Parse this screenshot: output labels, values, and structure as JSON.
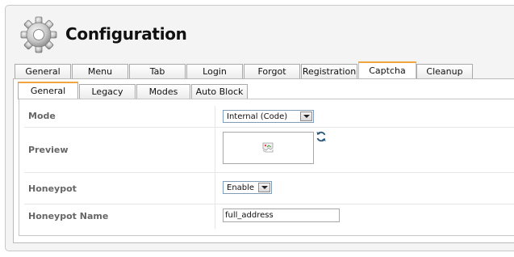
{
  "header": {
    "title": "Configuration",
    "icon": "gear-icon"
  },
  "main_tabs": [
    {
      "label": "General",
      "active": false
    },
    {
      "label": "Menu",
      "active": false
    },
    {
      "label": "Tab",
      "active": false
    },
    {
      "label": "Login",
      "active": false
    },
    {
      "label": "Forgot Login",
      "active": false
    },
    {
      "label": "Registration",
      "active": false
    },
    {
      "label": "Captcha",
      "active": true
    },
    {
      "label": "Cleanup",
      "active": false
    }
  ],
  "sub_tabs": [
    {
      "label": "General",
      "active": true
    },
    {
      "label": "Legacy",
      "active": false
    },
    {
      "label": "Modes",
      "active": false
    },
    {
      "label": "Auto Block",
      "active": false
    }
  ],
  "settings": {
    "mode": {
      "label": "Mode",
      "value": "Internal (Code)"
    },
    "preview": {
      "label": "Preview",
      "image_icon": "broken-image-icon",
      "refresh_icon": "refresh-icon"
    },
    "honeypot": {
      "label": "Honeypot",
      "value": "Enable"
    },
    "honeypot_name": {
      "label": "Honeypot Name",
      "value": "full_address"
    }
  },
  "colors": {
    "active_tab_accent": "#f0a640",
    "label_text": "#666666",
    "panel_bg": "#f4f4f4"
  }
}
